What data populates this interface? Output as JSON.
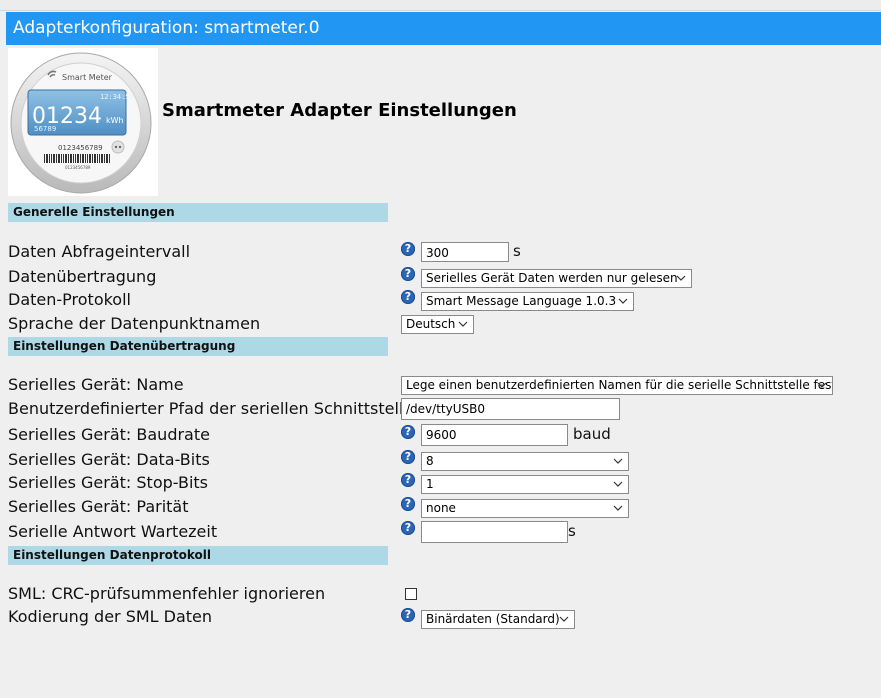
{
  "window": {
    "title": "Adapterkonfiguration: smartmeter.0"
  },
  "header": {
    "heading": "Smartmeter Adapter Einstellungen",
    "meter_image": {
      "brand": "Smart Meter",
      "time": "12:34:56",
      "reading": "01234",
      "unit": "kWh",
      "sub_reading": "56789",
      "serial": "0123456789",
      "barcode_text": "0123456789"
    }
  },
  "sections": {
    "general": "Generelle Einstellungen",
    "transfer": "Einstellungen Datenübertragung",
    "protocol": "Einstellungen Datenprotokoll"
  },
  "help_glyph": "?",
  "fields": {
    "interval": {
      "label": "Daten Abfrageintervall",
      "value": "300",
      "unit": "s"
    },
    "transfer": {
      "label": "Datenübertragung",
      "selected": "Serielles Gerät Daten werden nur gelesen"
    },
    "protocol": {
      "label": "Daten-Protokoll",
      "selected": "Smart Message Language 1.0.3"
    },
    "language": {
      "label": "Sprache der Datenpunktnamen",
      "selected": "Deutsch"
    },
    "serial_name": {
      "label": "Serielles Gerät: Name",
      "selected": "Lege einen benutzerdefinierten Namen für die serielle Schnittstelle fest"
    },
    "custom_path": {
      "label": "Benutzerdefinierter Pfad der seriellen Schnittstelle",
      "value": "/dev/ttyUSB0"
    },
    "baudrate": {
      "label": "Serielles Gerät: Baudrate",
      "value": "9600",
      "unit": "baud"
    },
    "databits": {
      "label": "Serielles Gerät: Data-Bits",
      "selected": "8"
    },
    "stopbits": {
      "label": "Serielles Gerät: Stop-Bits",
      "selected": "1"
    },
    "parity": {
      "label": "Serielles Gerät: Parität",
      "selected": "none"
    },
    "timeout": {
      "label": "Serielle Antwort Wartezeit",
      "value": "",
      "unit": "s"
    },
    "crc": {
      "label": "SML: CRC-prüfsummenfehler ignorieren",
      "checked": false
    },
    "encoding": {
      "label": "Kodierung der SML Daten",
      "selected": "Binärdaten (Standard)"
    }
  }
}
